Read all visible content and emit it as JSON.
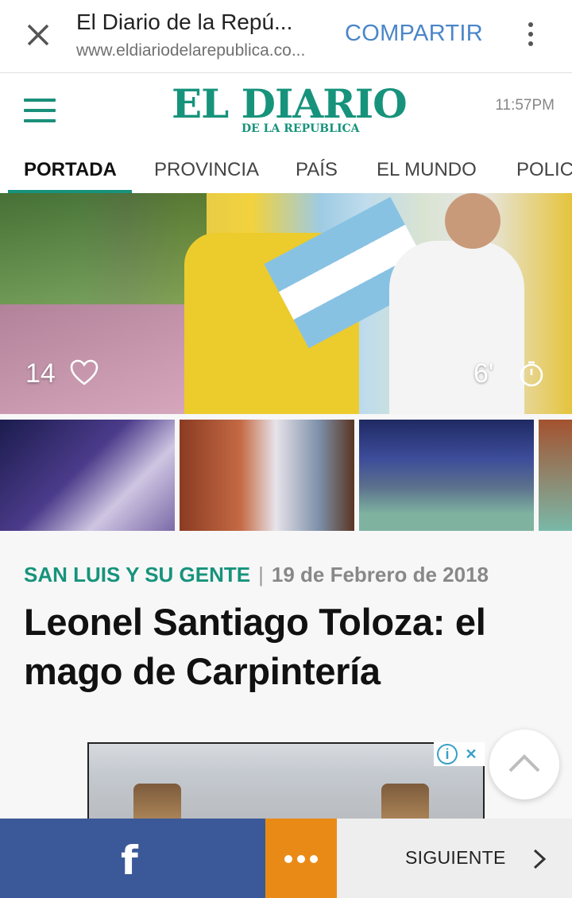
{
  "browser": {
    "page_title": "El Diario de la Repú...",
    "url": "www.eldiariodelarepublica.co...",
    "share_label": "COMPARTIR",
    "close_icon": "close-icon",
    "menu_icon": "more-vert-icon"
  },
  "site": {
    "logo_main": "EL DIARIO",
    "logo_sub": "DE LA REPUBLICA",
    "time": "11:57PM",
    "brand_color": "#17937c"
  },
  "nav": {
    "tabs": [
      {
        "label": "PORTADA",
        "active": true
      },
      {
        "label": "PROVINCIA",
        "active": false
      },
      {
        "label": "PAÍS",
        "active": false
      },
      {
        "label": "EL MUNDO",
        "active": false
      },
      {
        "label": "POLIC",
        "active": false
      }
    ]
  },
  "hero": {
    "likes": "14",
    "read_time": "6'"
  },
  "article": {
    "category": "SAN LUIS Y SU GENTE",
    "separator": "|",
    "date": "19 de Febrero de 2018",
    "headline": "Leonel Santiago Toloza: el mago de Carpintería"
  },
  "ad": {
    "info_icon": "info-icon",
    "close_icon": "close-icon"
  },
  "bottom": {
    "facebook_label": "f",
    "more_icon": "more-horiz-icon",
    "next_label": "SIGUIENTE",
    "facebook_color": "#3b5998",
    "more_color": "#ea8a16"
  }
}
